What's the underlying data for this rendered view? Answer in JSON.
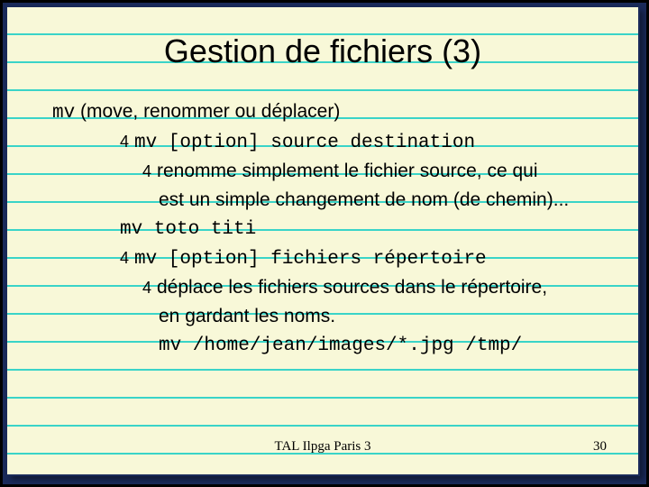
{
  "title": "Gestion de fichiers (3)",
  "line1_cmd": "mv",
  "line1_rest": " (move, renommer ou déplacer)",
  "bullet_glyph": "4",
  "line2": "mv [option] source destination",
  "line3a": "renomme simplement le fichier source, ce qui",
  "line3b": "est un simple changement de nom (de chemin)...",
  "line4": "mv toto titi",
  "line5": "mv [option] fichiers répertoire",
  "line6a": "déplace les fichiers sources dans le répertoire,",
  "line6b": "en gardant les noms.",
  "line7": "mv /home/jean/images/*.jpg  /tmp/",
  "footer_center": "TAL Ilpga Paris 3",
  "footer_right": "30"
}
